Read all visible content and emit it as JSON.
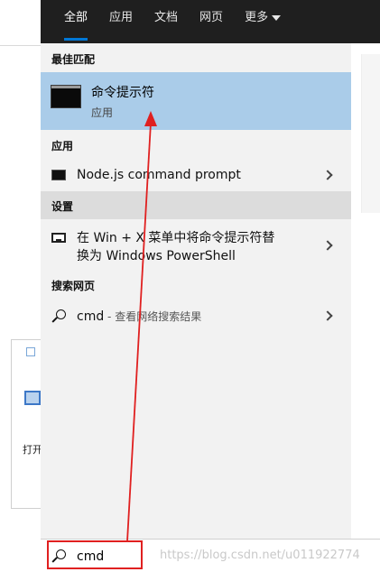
{
  "tabs": [
    {
      "label": "全部",
      "active": true
    },
    {
      "label": "应用",
      "active": false
    },
    {
      "label": "文档",
      "active": false
    },
    {
      "label": "网页",
      "active": false
    },
    {
      "label": "更多",
      "active": false
    }
  ],
  "best_match": {
    "section": "最佳匹配",
    "name": "命令提示符",
    "type": "应用",
    "icon": "console-icon"
  },
  "apps": {
    "section": "应用",
    "items": [
      {
        "name": "Node.js command prompt",
        "icon": "console-icon"
      }
    ]
  },
  "settings": {
    "section": "设置",
    "items": [
      {
        "line1": "在 Win + X 菜单中将命令提示符替",
        "line2": "换为 Windows PowerShell",
        "icon": "monitor-icon"
      }
    ]
  },
  "web": {
    "section": "搜索网页",
    "query": "cmd",
    "suffix": " - 查看网络搜索结果",
    "icon": "search-icon"
  },
  "search_box": {
    "value": "cmd",
    "icon": "search-icon"
  },
  "background": {
    "dialog_text": "打开"
  },
  "watermark": "https://blog.csdn.net/u011922774",
  "colors": {
    "topbar": "#1f1f1f",
    "selected": "#aacce9",
    "accent": "#0078d7",
    "annotation": "#e02020"
  }
}
